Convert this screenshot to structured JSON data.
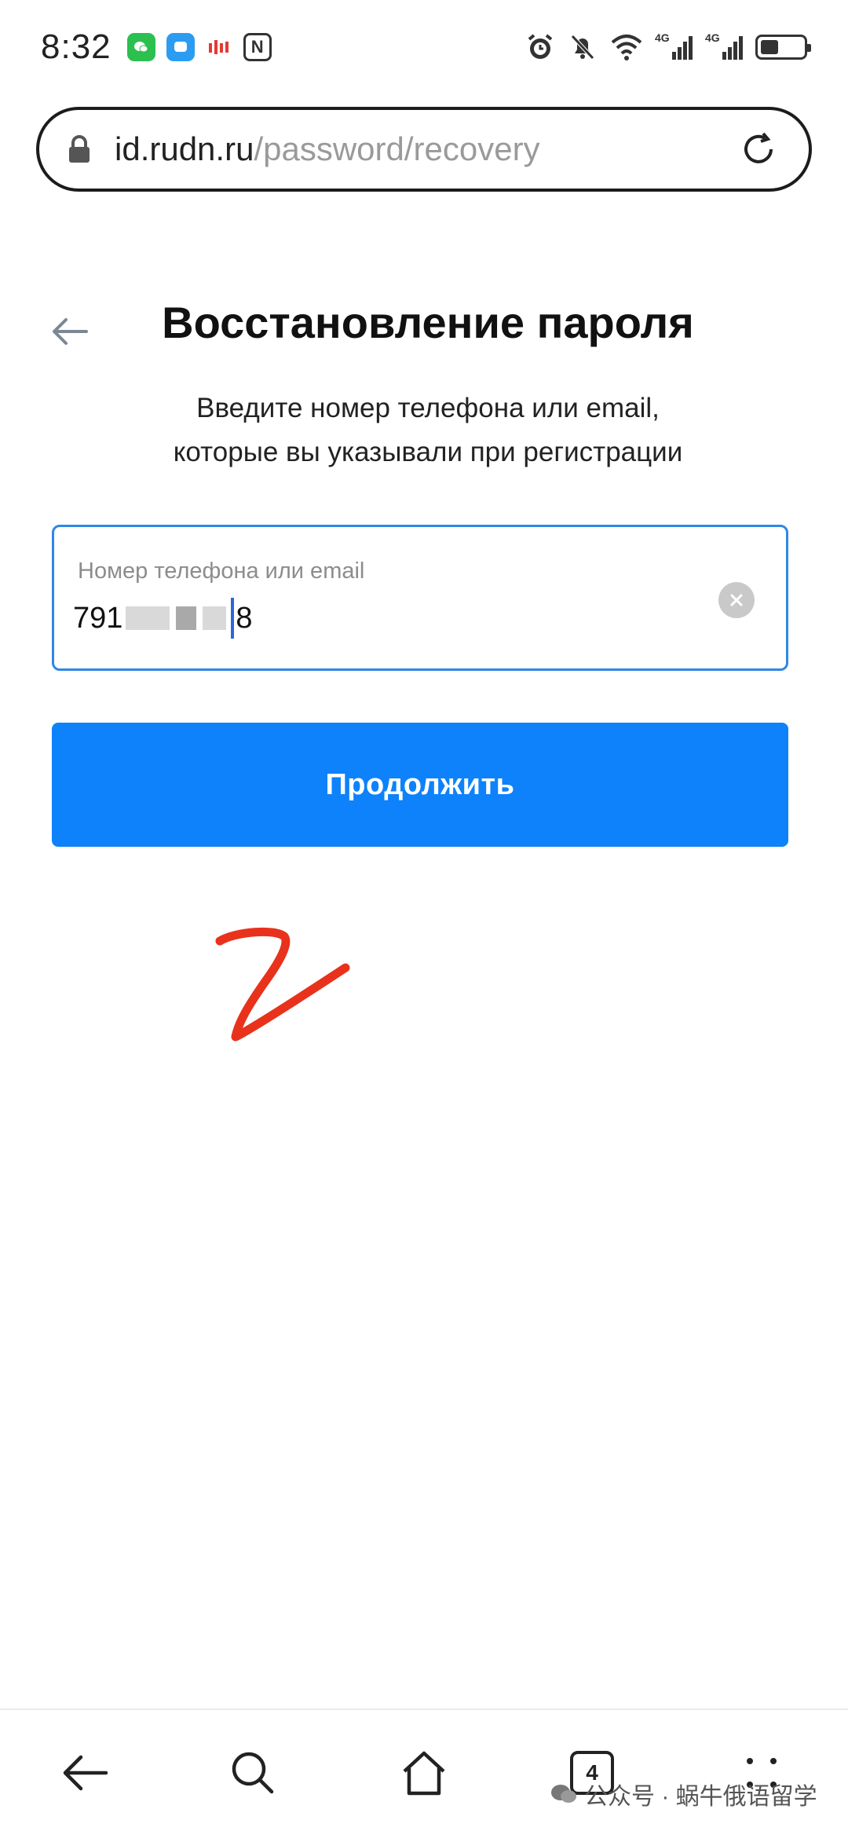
{
  "status_bar": {
    "time": "8:32",
    "network_1": "4G",
    "network_2": "4G",
    "battery_level": 0.4
  },
  "url_bar": {
    "host": "id.rudn.ru",
    "path": "/password/recovery"
  },
  "page": {
    "title": "Восстановление пароля",
    "subtitle_line1": "Введите номер телефона или email,",
    "subtitle_line2": "которые вы указывали при регистрации"
  },
  "form": {
    "field_label": "Номер телефона или email",
    "value_start": "791",
    "value_end": "8",
    "continue_label": "Продолжить"
  },
  "bottom_nav": {
    "tabs_count": "4"
  },
  "watermark": {
    "text": "公众号 · 蜗牛俄语留学"
  },
  "colors": {
    "accent": "#0d82fb",
    "input_border": "#2f87e6",
    "scribble": "#e8321c"
  }
}
